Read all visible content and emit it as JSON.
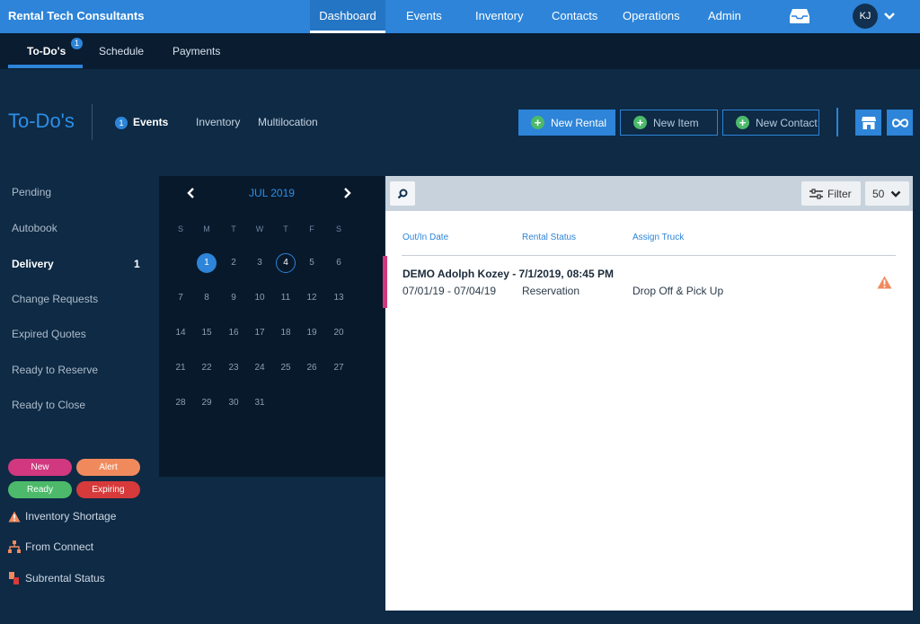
{
  "brand": "Rental Tech Consultants",
  "nav": [
    "Dashboard",
    "Events",
    "Inventory",
    "Contacts",
    "Operations",
    "Admin"
  ],
  "user_initials": "KJ",
  "subtabs": {
    "todos": "To-Do's",
    "todos_badge": "1",
    "schedule": "Schedule",
    "payments": "Payments"
  },
  "heading": {
    "title": "To-Do's",
    "events": "Events",
    "events_badge": "1",
    "inventory": "Inventory",
    "multilocation": "Multilocation"
  },
  "actions": {
    "new_rental": "New Rental",
    "new_item": "New Item",
    "new_contact": "New Contact"
  },
  "sidebar": {
    "items": [
      "Pending",
      "Autobook",
      "Delivery",
      "Change Requests",
      "Expired Quotes",
      "Ready to Reserve",
      "Ready to Close"
    ],
    "delivery_count": "1"
  },
  "status_pills": {
    "new": "New",
    "alert": "Alert",
    "ready": "Ready",
    "expiring": "Expiring"
  },
  "legend": {
    "shortage": "Inventory Shortage",
    "connect": "From Connect",
    "subrental": "Subrental Status"
  },
  "calendar": {
    "title": "JUL 2019",
    "dow": [
      "S",
      "M",
      "T",
      "W",
      "T",
      "F",
      "S"
    ],
    "days": [
      "1",
      "2",
      "3",
      "4",
      "5",
      "6",
      "7",
      "8",
      "9",
      "10",
      "11",
      "12",
      "13",
      "14",
      "15",
      "16",
      "17",
      "18",
      "19",
      "20",
      "21",
      "22",
      "23",
      "24",
      "25",
      "26",
      "27",
      "28",
      "29",
      "30",
      "31"
    ]
  },
  "panel": {
    "filter": "Filter",
    "per_page": "50",
    "columns": {
      "date": "Out/In Date",
      "status": "Rental Status",
      "truck": "Assign Truck"
    },
    "row": {
      "title": "DEMO Adolph Kozey - 7/1/2019, 08:45 PM",
      "dates": "07/01/19 - 07/04/19",
      "status": "Reservation",
      "truck": "Drop Off & Pick Up"
    }
  },
  "colors": {
    "accent": "#2d84d8",
    "green": "#4cba6a",
    "pink": "#d1387f",
    "orange": "#f08a5d",
    "red": "#d63a3a"
  }
}
